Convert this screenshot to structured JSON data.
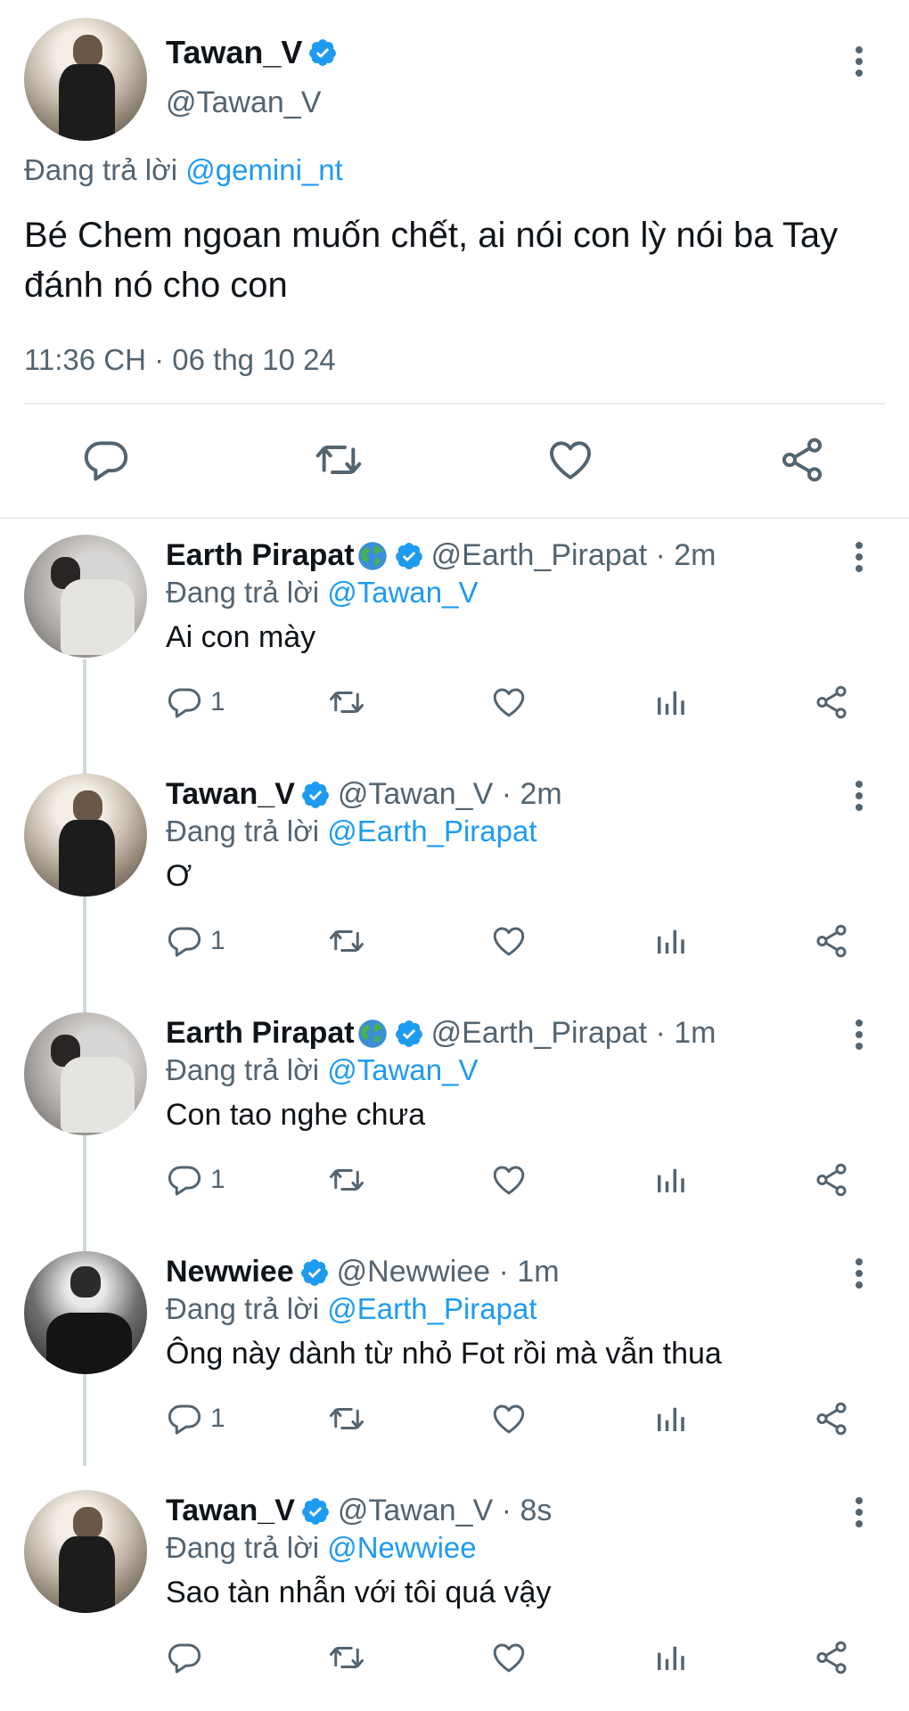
{
  "main_tweet": {
    "display_name": "Tawan_V",
    "handle": "@Tawan_V",
    "replying_prefix": "Đang trả lời",
    "replying_to": "@gemini_nt",
    "text": "Bé Chem ngoan muốn chết, ai nói con lỳ nói ba Tay đánh nó cho con",
    "timestamp": "11:36 CH · 06 thg 10 24",
    "actions": [
      "reply-icon",
      "retweet-icon",
      "like-icon",
      "share-icon"
    ]
  },
  "replies": [
    {
      "display_name": "Earth Pirapat",
      "has_globe_emoji": true,
      "handle_time": "@Earth_Pirapat · 2m",
      "replying_prefix": "Đang trả lời",
      "replying_to": "@Tawan_V",
      "text": "Ai con mày",
      "reply_count": "1"
    },
    {
      "display_name": "Tawan_V",
      "has_globe_emoji": false,
      "handle_time": "@Tawan_V · 2m",
      "replying_prefix": "Đang trả lời",
      "replying_to": "@Earth_Pirapat",
      "text": "Ơ",
      "reply_count": "1"
    },
    {
      "display_name": "Earth Pirapat",
      "has_globe_emoji": true,
      "handle_time": "@Earth_Pirapat · 1m",
      "replying_prefix": "Đang trả lời",
      "replying_to": "@Tawan_V",
      "text": "Con tao nghe chưa",
      "reply_count": "1"
    },
    {
      "display_name": "Newwiee",
      "has_globe_emoji": false,
      "handle_time": "@Newwiee · 1m",
      "replying_prefix": "Đang trả lời",
      "replying_to": "@Earth_Pirapat",
      "text": "Ông này dành từ nhỏ Fot rồi mà vẫn thua",
      "reply_count": "1"
    },
    {
      "display_name": "Tawan_V",
      "has_globe_emoji": false,
      "handle_time": "@Tawan_V · 8s",
      "replying_prefix": "Đang trả lời",
      "replying_to": "@Newwiee",
      "text": "Sao tàn nhẫn với tôi quá vậy",
      "reply_count": ""
    }
  ],
  "colors": {
    "accent": "#1d9bf0",
    "text": "#0f1419",
    "secondary": "#536471",
    "divider": "#e6ecf0"
  }
}
